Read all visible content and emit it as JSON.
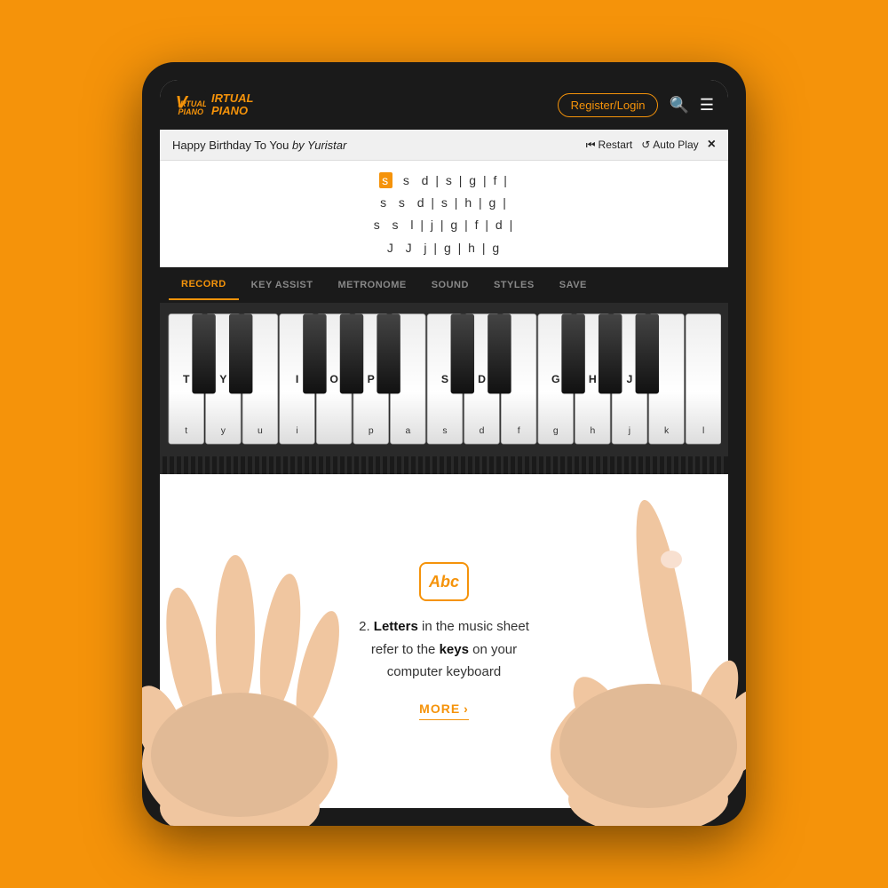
{
  "app": {
    "title": "VIRTUAL PIANO",
    "logo_letters": "VP"
  },
  "header": {
    "register_label": "Register/Login",
    "search_icon": "search",
    "menu_icon": "menu"
  },
  "song": {
    "title": "Happy Birthday To You",
    "author": "by Yuristar",
    "restart_label": "Restart",
    "autoplay_label": "Auto Play",
    "close_icon": "×"
  },
  "sheet": {
    "lines": [
      "s  s  d | s | g | f |",
      "s  s  d | s | h | g |",
      "s  s  l | j | g | f | d |",
      "J  J  j | g | h | g"
    ],
    "highlighted_note": "s"
  },
  "toolbar": {
    "tabs": [
      {
        "id": "record",
        "label": "RECORD",
        "active": true
      },
      {
        "id": "key-assist",
        "label": "KEY ASSIST",
        "active": false
      },
      {
        "id": "metronome",
        "label": "METRONOME",
        "active": false
      },
      {
        "id": "sound",
        "label": "SOUND",
        "active": false
      },
      {
        "id": "styles",
        "label": "STYLES",
        "active": false
      },
      {
        "id": "save",
        "label": "SAVE",
        "active": false
      }
    ]
  },
  "piano": {
    "white_keys": [
      "T",
      "Y",
      "U",
      "I",
      "O",
      "P",
      "A",
      "S",
      "D",
      "F",
      "G",
      "H",
      "J",
      "K",
      "L"
    ],
    "white_keys_lower": [
      "t",
      "y",
      "u",
      "i",
      "",
      "p",
      "a",
      "s",
      "d",
      "f",
      "g",
      "h",
      "j",
      "k",
      "l"
    ],
    "upper_labels": [
      "T",
      "Y",
      "",
      "I",
      "O",
      "P",
      "",
      "S",
      "D",
      "",
      "G",
      "H",
      "J",
      ""
    ],
    "lower_labels": [
      "t",
      "y",
      "u",
      "i",
      "",
      "p",
      "a",
      "s",
      "d",
      "f",
      "g",
      "h",
      "j",
      "k",
      "l"
    ]
  },
  "info": {
    "icon_text": "Abc",
    "text_part1": "2. ",
    "text_letters": "Letters",
    "text_part2": " in the music sheet",
    "text_part3": "refer to the ",
    "text_keys": "keys",
    "text_part4": " on your",
    "text_part5": "computer keyboard",
    "more_label": "MORE",
    "more_arrow": "›"
  },
  "colors": {
    "orange": "#F5930A",
    "dark": "#1a1a1a",
    "white": "#ffffff"
  }
}
